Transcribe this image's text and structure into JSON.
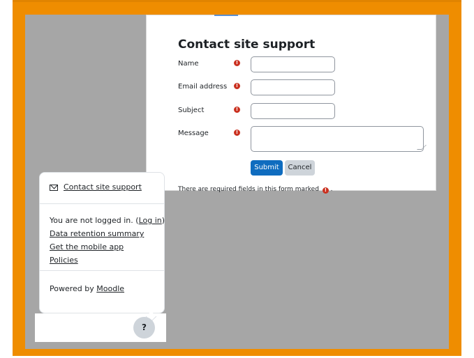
{
  "form": {
    "title": "Contact site support",
    "fields": [
      {
        "label": "Name",
        "value": ""
      },
      {
        "label": "Email address",
        "value": ""
      },
      {
        "label": "Subject",
        "value": ""
      },
      {
        "label": "Message",
        "value": ""
      }
    ],
    "required_icon": "!",
    "submit_label": "Submit",
    "cancel_label": "Cancel",
    "required_note": "There are required fields in this form marked",
    "required_note_end": "."
  },
  "footer": {
    "contact_link": "Contact site support",
    "logged_out_prefix": "You are not logged in. (",
    "login_link": "Log in",
    "logged_out_suffix": ")",
    "data_retention_link": "Data retention summary",
    "mobile_app_link": "Get the mobile app",
    "policies_link": "Policies",
    "powered_by": "Powered by ",
    "moodle_link": "Moodle"
  },
  "help_button_label": "?",
  "colors": {
    "frame": "#ef8d00",
    "backdrop": "#a6a6a6",
    "submit": "#0f6cbf",
    "required": "#ca3120"
  }
}
